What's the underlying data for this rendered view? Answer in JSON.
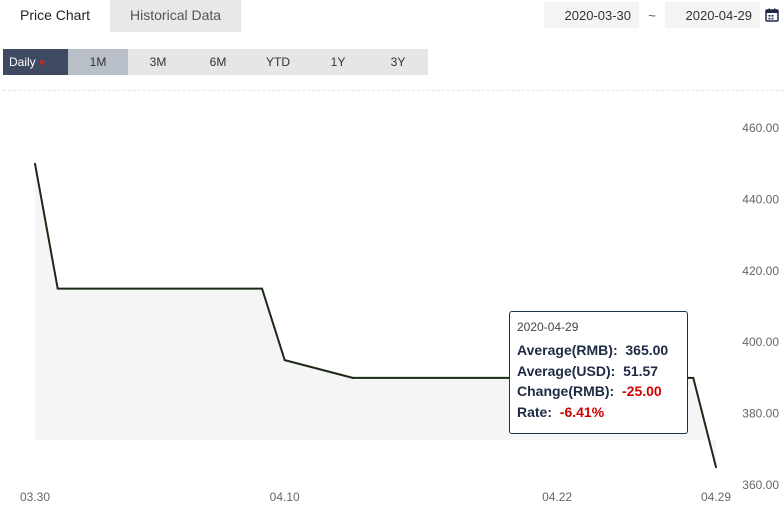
{
  "tabs": [
    {
      "label": "Price Chart",
      "active": true
    },
    {
      "label": "Historical Data",
      "active": false
    }
  ],
  "date_range": {
    "start": "2020-03-30",
    "separator": "~",
    "end": "2020-04-29"
  },
  "icons": {
    "calendar": "calendar-icon"
  },
  "range_buttons": {
    "daily": "Daily",
    "options": [
      "1M",
      "3M",
      "6M",
      "YTD",
      "1Y",
      "3Y"
    ],
    "selected": "1M"
  },
  "colors": {
    "line": "#1b2a14",
    "accent_dark": "#3e4a61",
    "negative": "#d00000"
  },
  "chart_data": {
    "type": "line",
    "x_ticks": [
      "03.30",
      "04.10",
      "04.22",
      "04.29"
    ],
    "y_ticks": [
      "460.00",
      "440.00",
      "420.00",
      "400.00",
      "380.00",
      "360.00"
    ],
    "ylim": [
      360,
      460
    ],
    "series": [
      {
        "points": [
          {
            "x": "03.30",
            "y": 450
          },
          {
            "x": "03.31",
            "y": 415
          },
          {
            "x": "04.09",
            "y": 415
          },
          {
            "x": "04.10",
            "y": 395
          },
          {
            "x": "04.13",
            "y": 390
          },
          {
            "x": "04.28",
            "y": 390
          },
          {
            "x": "04.29",
            "y": 365
          }
        ]
      }
    ],
    "tooltip": {
      "date": "2020-04-29",
      "avg_rmb_label": "Average(RMB):",
      "avg_rmb": "365.00",
      "avg_usd_label": "Average(USD):",
      "avg_usd": "51.57",
      "change_label": "Change(RMB):",
      "change": "-25.00",
      "rate_label": "Rate:",
      "rate": "-6.41%"
    }
  }
}
